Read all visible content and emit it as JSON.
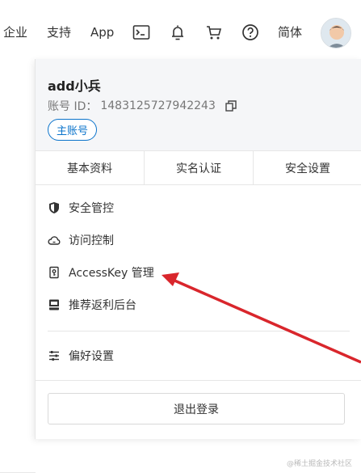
{
  "topbar": {
    "items": [
      {
        "label": "企业"
      },
      {
        "label": "支持"
      },
      {
        "label": "App"
      },
      {
        "label": "简体"
      }
    ],
    "icons": [
      "terminal-icon",
      "bell-icon",
      "cart-icon",
      "help-icon",
      "avatar"
    ]
  },
  "dropdown": {
    "username": "add小兵",
    "account_id_label": "账号 ID：",
    "account_id": "1483125727942243",
    "badge": "主账号",
    "tabs": [
      {
        "label": "基本资料"
      },
      {
        "label": "实名认证"
      },
      {
        "label": "安全设置"
      }
    ],
    "menu": [
      {
        "label": "安全管控",
        "icon": "shield-icon"
      },
      {
        "label": "访问控制",
        "icon": "cloud-icon"
      },
      {
        "label": "AccessKey 管理",
        "icon": "key-icon"
      },
      {
        "label": "推荐返利后台",
        "icon": "gift-icon"
      }
    ],
    "preferences": {
      "label": "偏好设置",
      "icon": "sliders-icon"
    },
    "logout": "退出登录"
  },
  "watermark": "@稀土掘金技术社区",
  "colors": {
    "accent": "#0a73cb",
    "arrow": "#d9262c"
  }
}
